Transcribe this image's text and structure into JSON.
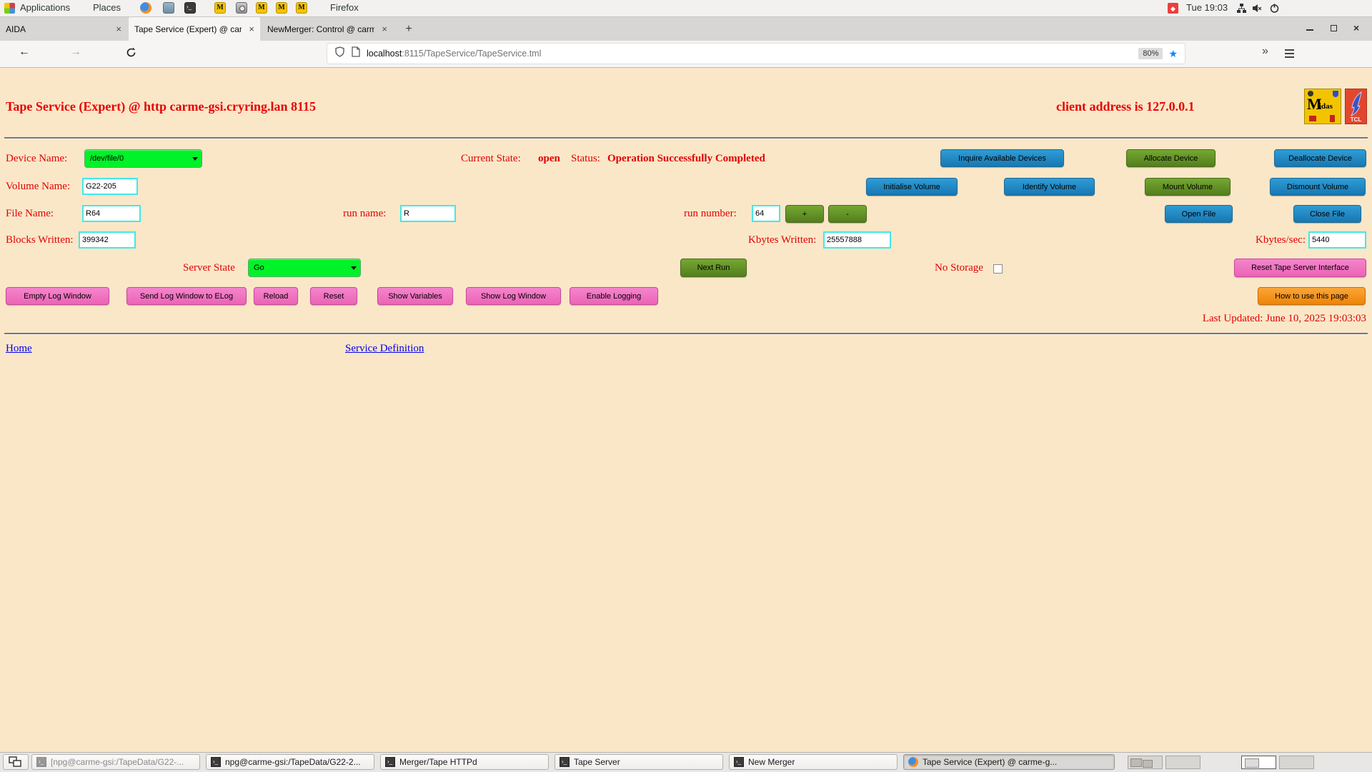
{
  "colors": {
    "page_bg": "#FAE7C8",
    "red_text": "#E20000",
    "green_select": "#00F228",
    "blue_button": "#1E87C4",
    "green_button": "#5E9322",
    "pink_button": "#F06EC0",
    "orange_button": "#F39018",
    "input_border": "#43E8E8",
    "link_blue": "#0000EE",
    "star_blue": "#0a84ff"
  },
  "desktop_top_bar": {
    "applications_label": "Applications",
    "places_label": "Places",
    "window_title": "Firefox",
    "clock": "Tue 19:03"
  },
  "browser": {
    "tabs": [
      {
        "title": "AIDA",
        "active": false
      },
      {
        "title": "Tape Service (Expert) @ carm",
        "active": true
      },
      {
        "title": "NewMerger: Control @ carm",
        "active": false
      }
    ],
    "url_host": "localhost",
    "url_rest": ":8115/TapeService/TapeService.tml",
    "zoom_badge": "80%"
  },
  "page": {
    "title": "Tape Service (Expert) @ http carme-gsi.cryring.lan 8115",
    "client_address": "client address is 127.0.0.1",
    "logos": {
      "midas_big": "M",
      "midas_small": "idas",
      "tcl": "TCL"
    },
    "row_device": {
      "label": "Device Name:",
      "device_select_value": "/dev/file/0",
      "current_state_label": "Current State:",
      "current_state_value": "open",
      "status_label": "Status:",
      "status_value": "Operation Successfully Completed",
      "inquire_button": "Inquire Available Devices",
      "allocate_button": "Allocate Device",
      "deallocate_button": "Deallocate Device"
    },
    "row_volume": {
      "label": "Volume Name:",
      "value": "G22-205",
      "initialise_button": "Initialise Volume",
      "identify_button": "Identify Volume",
      "mount_button": "Mount Volume",
      "dismount_button": "Dismount Volume"
    },
    "row_file": {
      "label": "File Name:",
      "value": "R64",
      "run_name_label": "run name:",
      "run_name_value": "R",
      "run_number_label": "run number:",
      "run_number_value": "64",
      "increment_button": "+",
      "decrement_button": "-",
      "open_button": "Open File",
      "close_button": "Close File"
    },
    "row_stats": {
      "blocks_label": "Blocks Written:",
      "blocks_value": "399342",
      "kbytes_label": "Kbytes Written:",
      "kbytes_value": "25557888",
      "rate_label": "Kbytes/sec:",
      "rate_value": "5440"
    },
    "row_server": {
      "label": "Server State",
      "value": "Go",
      "next_run_button": "Next Run",
      "no_storage_label": "No Storage",
      "reset_button": "Reset Tape Server Interface"
    },
    "log_buttons": [
      "Empty Log Window",
      "Send Log Window to ELog",
      "Reload",
      "Reset",
      "Show Variables",
      "Show Log Window",
      "Enable Logging"
    ],
    "help_button": "How to use this page",
    "last_updated": "Last Updated: June 10, 2025 19:03:03",
    "links": [
      {
        "label": "Home"
      },
      {
        "label": "Service Definition"
      }
    ]
  },
  "taskbar": {
    "tasks": [
      {
        "label": "[npg@carme-gsi:/TapeData/G22-...",
        "icon": "terminal-icon",
        "minimized": true
      },
      {
        "label": "npg@carme-gsi:/TapeData/G22-2...",
        "icon": "terminal-icon",
        "minimized": false
      },
      {
        "label": "Merger/Tape HTTPd",
        "icon": "terminal-icon",
        "minimized": false
      },
      {
        "label": "Tape Server",
        "icon": "terminal-icon",
        "minimized": false
      },
      {
        "label": "New Merger",
        "icon": "terminal-icon",
        "minimized": false
      },
      {
        "label": "Tape Service (Expert) @ carme-g...",
        "icon": "firefox-icon",
        "active": true
      }
    ]
  }
}
